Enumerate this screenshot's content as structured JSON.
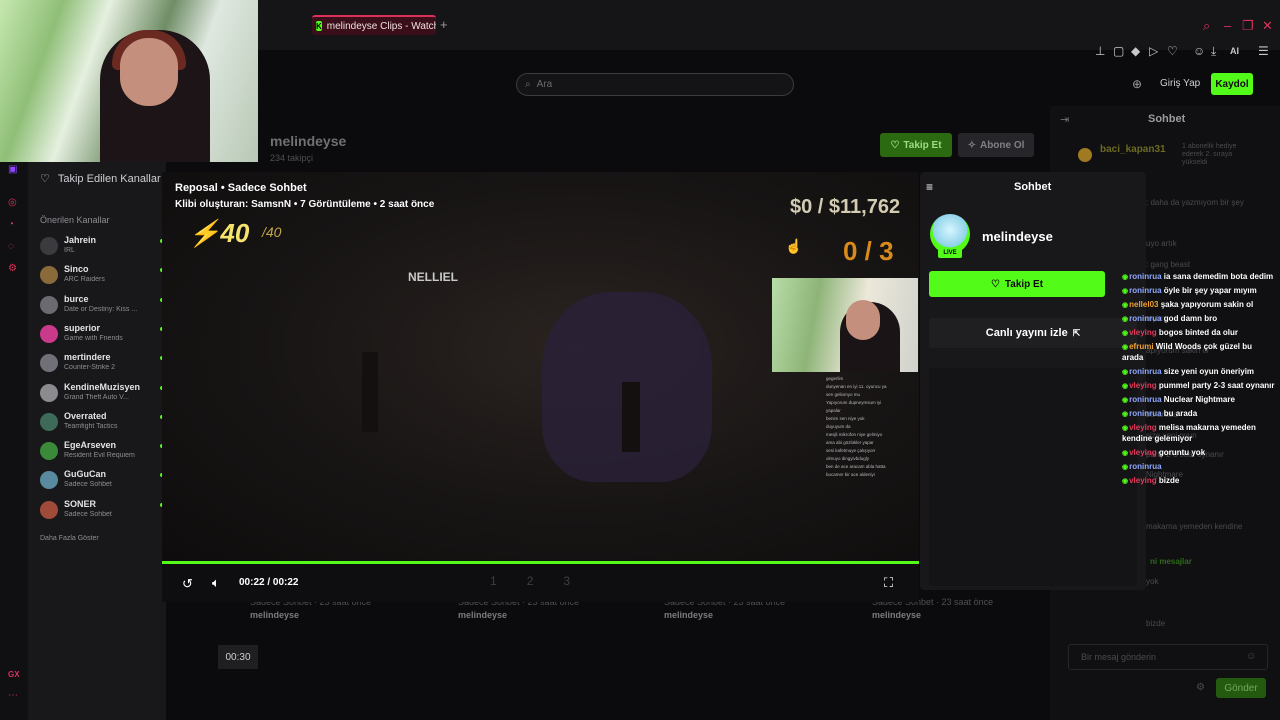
{
  "browser": {
    "tab_title": "melindeyse Clips - Watch",
    "tab_favicon": "K",
    "new_tab": "+",
    "ai_label": "AI"
  },
  "header": {
    "search_placeholder": "Ara",
    "login": "Giriş Yap",
    "signup": "Kaydol"
  },
  "sidebar": {
    "following": "Takip Edilen Kanallar",
    "recommended": "Önerilen Kanallar",
    "channels": [
      {
        "name": "Jahrein",
        "game": "IRL",
        "color": "#3a3a3f"
      },
      {
        "name": "Sinco",
        "game": "ARC Raiders",
        "color": "#8a6a3a"
      },
      {
        "name": "burce",
        "game": "Date or Destiny: Kiss ...",
        "color": "#6a6a70"
      },
      {
        "name": "superior",
        "game": "Game with Friends",
        "color": "#c93a8a"
      },
      {
        "name": "mertindere",
        "game": "Counter-Strike 2",
        "color": "#707078"
      },
      {
        "name": "KendineMuzisyen",
        "game": "Grand Theft Auto V...",
        "color": "#8a8a8f"
      },
      {
        "name": "Overrated",
        "game": "Teamfight Tactics",
        "color": "#3e6a5a"
      },
      {
        "name": "EgeArseven",
        "game": "Resident Evil Requiem",
        "color": "#3a8a3a"
      },
      {
        "name": "GuGuCan",
        "game": "Sadece Sohbet",
        "color": "#5a8aa0"
      },
      {
        "name": "SONER",
        "game": "Sadece Sohbet",
        "color": "#a04a3a"
      }
    ],
    "show_more": "Daha Fazla Göster"
  },
  "channel": {
    "name": "melindeyse",
    "followers": "234 takipçi",
    "follow": "Takip Et",
    "subscribe": "Abone Ol"
  },
  "clip": {
    "title": "Reposal • Sadece Sohbet",
    "meta": "Klibi oluşturan: SamsnN • 7 Görüntüleme • 2 saat önce",
    "hud_hp": "40",
    "hud_max": "/40",
    "hud_money": "$0 / $11,762",
    "hud_count": "0 / 3",
    "hud_name": "NELLIEL",
    "time": "00:22 / 00:22",
    "progress": 1.0,
    "chapters": [
      "1",
      "2",
      "3"
    ]
  },
  "chat_panel": {
    "title": "Sohbet",
    "streamer": "melindeyse",
    "live": "LIVE",
    "follow": "Takip Et",
    "watch_live": "Canlı yayını izle"
  },
  "bg_chat": {
    "title": "Sohbet",
    "top_user": "baci_kapan31",
    "top_note": "1 abonelik hediye ederek 2. sıraya yükseldi",
    "lines": [
      ": daha da yazmıyom bir şey",
      "uyo artık",
      ": gang beast",
      "myim",
      "apıyorum sakin ol",
      "bu arada",
      "size yeni oyun",
      "party 2-3 saat oynanır",
      "Nightmare",
      "makarna yemeden kendine",
      "ni mesajlar",
      "yok",
      "bizde"
    ],
    "placeholder": "Bir mesaj gönderin",
    "send": "Gönder"
  },
  "clip_cards": [
    {
      "cat": "Sadece Sohbet · 23 saat önce",
      "name": "melindeyse"
    },
    {
      "cat": "Sadece Sohbet · 23 saat önce",
      "name": "melindeyse"
    },
    {
      "cat": "Sadece Sohbet · 23 saat önce",
      "name": "melindeyse"
    },
    {
      "cat": "Sadece Sohbet · 23 saat önce",
      "name": "melindeyse"
    }
  ],
  "thumb_duration": "00:30",
  "chat_messages": [
    {
      "user": "roninrua",
      "text": "ia sana demedim bota dedim",
      "color": "#8fa8ff"
    },
    {
      "user": "roninrua",
      "text": "öyle bir şey yapar mıyım",
      "color": "#8fa8ff"
    },
    {
      "user": "nellel03",
      "text": "şaka yapıyorum sakin ol",
      "color": "#f0a030"
    },
    {
      "user": "roninrua",
      "text": "god damn bro",
      "color": "#8fa8ff"
    },
    {
      "user": "vleying",
      "text": "bogos binted da olur",
      "color": "#e03a5a"
    },
    {
      "user": "efrumi",
      "text": "Wild Woods çok güzel bu arada",
      "color": "#f0a030"
    },
    {
      "user": "roninrua",
      "text": "size yeni oyun öneriyim",
      "color": "#8fa8ff"
    },
    {
      "user": "vleying",
      "text": "pummel party 2-3 saat oynanır",
      "color": "#e03a5a"
    },
    {
      "user": "roninrua",
      "text": "Nuclear Nightmare",
      "color": "#8fa8ff"
    },
    {
      "user": "roninrua",
      "text": "bu arada",
      "color": "#8fa8ff"
    },
    {
      "user": "vleying",
      "text": "melisa makarna yemeden kendine gelemiyor",
      "color": "#e03a5a"
    },
    {
      "user": "vleying",
      "text": "goruntu yok",
      "color": "#e03a5a"
    },
    {
      "user": "roninrua",
      "text": "",
      "color": "#8fa8ff"
    },
    {
      "user": "vleying",
      "text": "bizde",
      "color": "#e03a5a"
    }
  ],
  "overlay_chat_lines": [
    "gegerlim",
    "dunyenan en iyi 11. oyuncu ya",
    "sen geliomyo mu",
    "Yapıyorum dupneymsum iyi",
    "yapalar",
    "benim sen niye yok",
    "duyuyum da",
    "mesjli mikrofon niye gelmiyo",
    "ama abi gözlükler yapar",
    "sesi kafetmuye çalışıyorr",
    "olmuyo dingyivbdugly",
    "ben de ace aracam abla hatta",
    "bucamer bir ace aldeniyi"
  ],
  "colors": {
    "brand_green": "#53fc18",
    "accent_red": "#d9315a"
  }
}
